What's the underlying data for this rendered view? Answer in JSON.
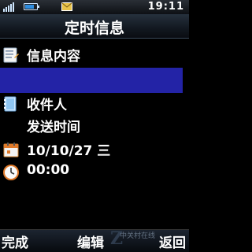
{
  "statusbar": {
    "time": "19:11",
    "icons": [
      "signal-icon",
      "battery-icon",
      "message-icon"
    ]
  },
  "title": "定时信息",
  "items": {
    "content": "信息内容",
    "recipient": "收件人",
    "send_time": "发送时间",
    "date": "10/10/27 三",
    "time": "00:00"
  },
  "softkeys": {
    "left": "完成",
    "middle": "编辑",
    "right": "返回"
  },
  "watermark": {
    "small": "中关村在线",
    "big": "Z"
  },
  "colors": {
    "input_highlight": "#2323a6",
    "background": "#000000"
  }
}
